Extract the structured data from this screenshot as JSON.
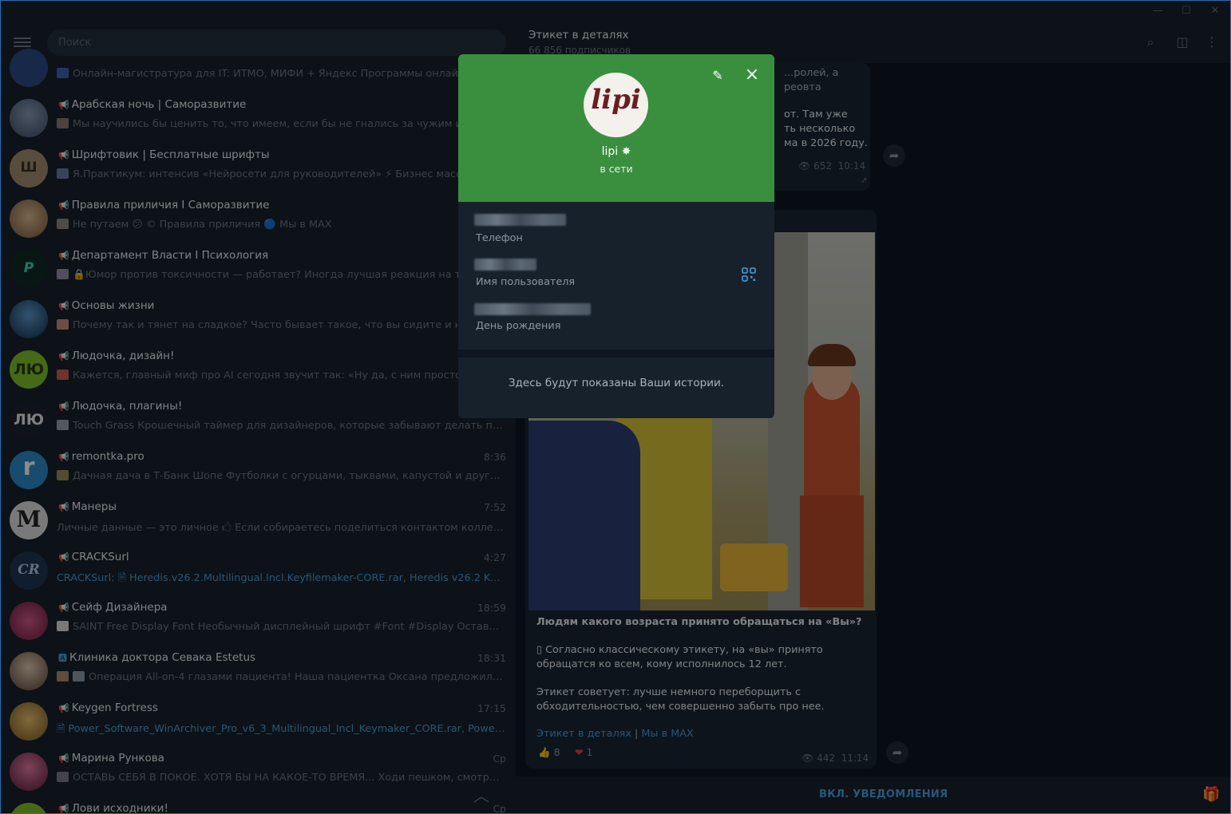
{
  "window": {
    "controls": {
      "minimize": "—",
      "maximize": "☐",
      "close": "✕"
    }
  },
  "sidebar": {
    "search_placeholder": "Поиск",
    "chats": [
      {
        "name": "",
        "time": "",
        "preview": "Онлайн-магистратура для IT: ИТМО, МИФИ + Яндекс  Программы онлайн-ма...",
        "avatar_color": "#2d4a86",
        "avatar_text": ""
      },
      {
        "name": "Арабская ночь | Саморазвитие",
        "time": "",
        "preview": "Мы научились бы ценить то, что имеем, если бы не гнались за чужим и име...",
        "avatar_color": "#5b6d8a",
        "avatar_text": ""
      },
      {
        "name": "Шрифтовик | Бесплатные шрифты",
        "time": "",
        "preview": "Я.Практикум: интенсив «Нейросети для руководителей»  ⚡ Бизнес массово...",
        "avatar_color": "#8e7a5e",
        "avatar_text": "Ш"
      },
      {
        "name": "Правила приличия I Саморазвитие",
        "time": "",
        "preview": "Не путаем 😕 © Правила приличия  🔵 Мы в MAX",
        "avatar_color": "#b08f6b",
        "avatar_text": ""
      },
      {
        "name": "Департамент Власти I Психология",
        "time": "",
        "preview": "🔒Юмор против токсичности — работает? Иногда лучшая реакция на токс...",
        "avatar_color": "#15403a",
        "avatar_text": "Р"
      },
      {
        "name": "Основы жизни",
        "time": "",
        "preview": "Почему так и тянет на сладкое?  Часто бывает такое, что вы сидите и нео...",
        "avatar_color": "#274a66",
        "avatar_text": ""
      },
      {
        "name": "Людочка, дизайн!",
        "time": "",
        "preview": "Кажется, главный миф про AI сегодня звучит так: «Ну да, с ним просто можн...",
        "avatar_color": "#7fbf2a",
        "avatar_text": "ЛЮ"
      },
      {
        "name": "Людочка, плагины!",
        "time": "",
        "preview": "Touch Grass  Крошечный таймер для дизайнеров, которые забывают делать перер...",
        "avatar_color": "#2a2f3a",
        "avatar_text": "ЛЮ"
      },
      {
        "name": "remontka.pro",
        "time": "8:36",
        "preview": "Дачная дача в Т-Банк Шопе  Футболки с огурцами, тыквами, капустой и другие крут...",
        "avatar_color": "#2c8ac9",
        "avatar_text": "r"
      },
      {
        "name": "Манеры",
        "time": "7:52",
        "preview": "Личные данные — это личное  🖒  Если собираетесь поделиться контактом коллеги ил...",
        "avatar_color": "#d8d8d8",
        "avatar_text": "M"
      },
      {
        "name": "CRACKSurl",
        "time": "4:27",
        "preview_prefix": "CRACKSurl: ",
        "preview": "Heredis.v26.2.Multilingual.Incl.Keyfilemaker-CORE.rar, Heredis v26.2 Keyfile...",
        "avatar_color": "#1e3550",
        "avatar_text": "CR"
      },
      {
        "name": "Сейф Дизайнера",
        "time": "18:59",
        "preview": "SAINT Free Display Font  Необычный дисплейный шрифт  #Font #Display  Оставляй...",
        "avatar_color": "#c94a7a",
        "avatar_text": ""
      },
      {
        "name": "Клиника доктора Севака Estetus",
        "time": "18:31",
        "preview": "Операция All-on-4 глазами пациента!  Наша пациентка Оксана предложила оче...",
        "avatar_color": "#8a6f5e",
        "avatar_text": ""
      },
      {
        "name": "Keygen Fortress",
        "time": "17:15",
        "preview": "Power_Software_WinArchiver_Pro_v6_3_Multilingual_Incl_Keymaker_CORE.rar, Power.S...",
        "avatar_color": "#c9a35a",
        "avatar_text": ""
      },
      {
        "name": "Марина Рункова",
        "time": "Ср",
        "preview": "ОСТАВЬ СЕБЯ В ПОКОЕ. ХОТЯ БЫ НА КАКОЕ-ТО ВРЕМЯ... Ходи пешком, смотри по ст...",
        "avatar_color": "#b0466a",
        "avatar_text": ""
      },
      {
        "name": "Лови исходники!",
        "time": "Ср",
        "preview": "",
        "avatar_color": "#7fbf2a",
        "avatar_text": ""
      }
    ]
  },
  "channel": {
    "title": "Этикет в деталях",
    "subtitle": "66 856 подписчиков",
    "msg1_lines": [
      "...ролей, а реовта",
      "от. Там уже",
      "ть несколько",
      "ма в 2026 году."
    ],
    "msg1_views": "652",
    "msg1_time": "10:14",
    "post_title": "Людям какого возраста принято обращаться на  «Вы»?",
    "post_p1": "Согласно классическому этикету, на «вы» принято обращатся ко всем, кому исполнилось 12 лет.",
    "post_p2": "Этикет советует: лучше немного переборщить с обходительностью, чем совершенно забыть про нее.",
    "post_link1": "Этикет в деталях",
    "post_link_sep": "|",
    "post_link2": "Мы в MAX",
    "reaction1_emoji": "👍",
    "reaction1_count": "8",
    "reaction2_emoji": "❤",
    "reaction2_count": "1",
    "post_views": "442",
    "post_time": "11:14",
    "notifications_button": "ВКЛ. УВЕДОМЛЕНИЯ"
  },
  "profile": {
    "avatar_logo": "lipi",
    "name": "lipi",
    "status": "в сети",
    "phone_label": "Телефон",
    "username_label": "Имя пользователя",
    "birthday_label": "День рождения",
    "stories_text": "Здесь будут показаны Ваши истории."
  },
  "colors": {
    "accent": "#4b9ed9",
    "profile_header": "#3a8f3f",
    "background": "#0e1621",
    "panel": "#17212b"
  }
}
